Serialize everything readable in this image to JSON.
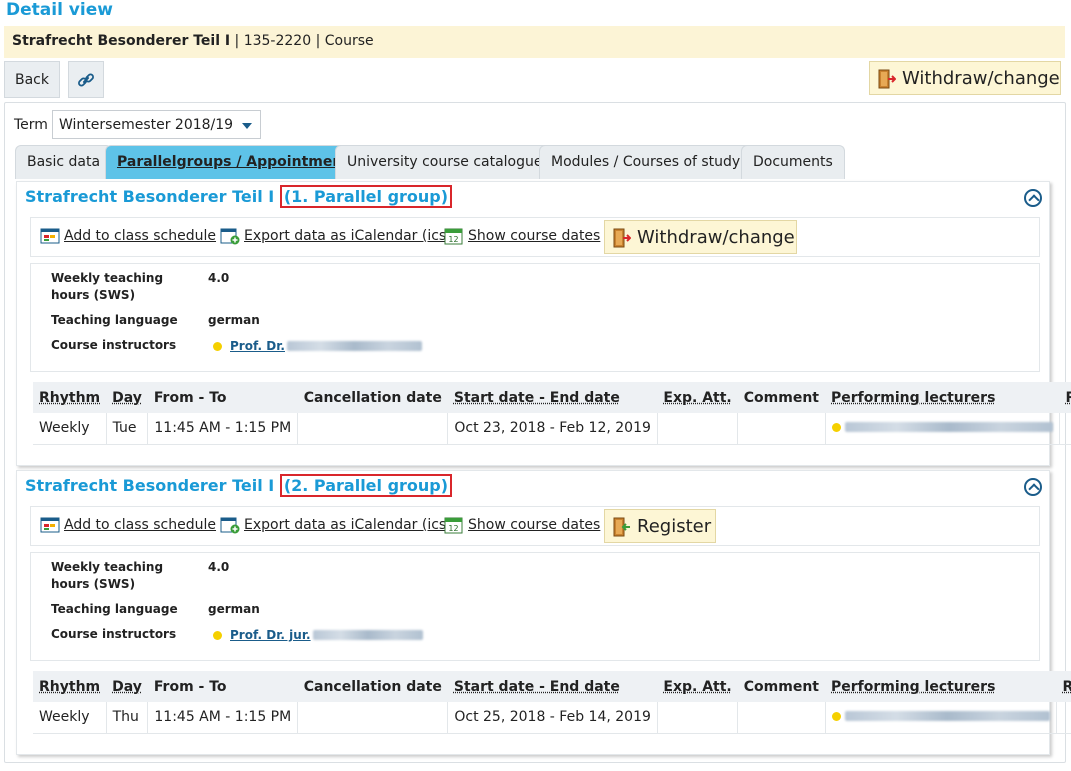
{
  "page": {
    "title": "Detail view"
  },
  "course": {
    "name": "Strafrecht Besonderer Teil I",
    "meta": " | 135-2220 | Course"
  },
  "toolbar": {
    "back_label": "Back",
    "withdraw_label": "Withdraw/change"
  },
  "term": {
    "label": "Term",
    "value": "Wintersemester 2018/19"
  },
  "tabs": [
    {
      "label": "Basic data"
    },
    {
      "label": "Parallelgroups / Appointments"
    },
    {
      "label": "University course catalogue"
    },
    {
      "label": "Modules / Courses of study"
    },
    {
      "label": "Documents"
    }
  ],
  "actions": {
    "add_schedule": "Add to class schedule",
    "export_ical": "Export data as iCalendar (ics)",
    "show_dates": "Show course dates"
  },
  "detail_labels": {
    "sws": "Weekly teaching hours (SWS)",
    "language": "Teaching language",
    "instructors": "Course instructors"
  },
  "table_headers": {
    "rhythm": "Rhythm",
    "day": "Day",
    "from_to": "From - To",
    "cancellation": "Cancellation date",
    "start_end": "Start date - End date",
    "exp_att": "Exp. Att.",
    "comment": "Comment",
    "lecturers": "Performing lecturers",
    "room": "Room"
  },
  "groups": [
    {
      "title": "Strafrecht Besonderer Teil I",
      "group_label": "(1. Parallel group)",
      "action_button": "Withdraw/change",
      "sws": "4.0",
      "language": "german",
      "instructor": "Prof. Dr.",
      "row": {
        "rhythm": "Weekly",
        "day": "Tue",
        "time": "11:45 AM - 1:15 PM",
        "cancellation": "",
        "dates": "Oct 23, 2018 - Feb 12, 2019",
        "exp_att": "",
        "comment": "",
        "room": ""
      }
    },
    {
      "title": "Strafrecht Besonderer Teil I",
      "group_label": "(2. Parallel group)",
      "action_button": "Register",
      "sws": "4.0",
      "language": "german",
      "instructor": "Prof. Dr. jur.",
      "row": {
        "rhythm": "Weekly",
        "day": "Thu",
        "time": "11:45 AM - 1:15 PM",
        "cancellation": "",
        "dates": "Oct 25, 2018 - Feb 14, 2019",
        "exp_att": "",
        "comment": "",
        "room": ""
      }
    }
  ],
  "colors": {
    "accent": "#1a9ad6",
    "banner": "#fcf4d6",
    "active_tab": "#5ec3e8",
    "highlight": "#d9262b"
  }
}
